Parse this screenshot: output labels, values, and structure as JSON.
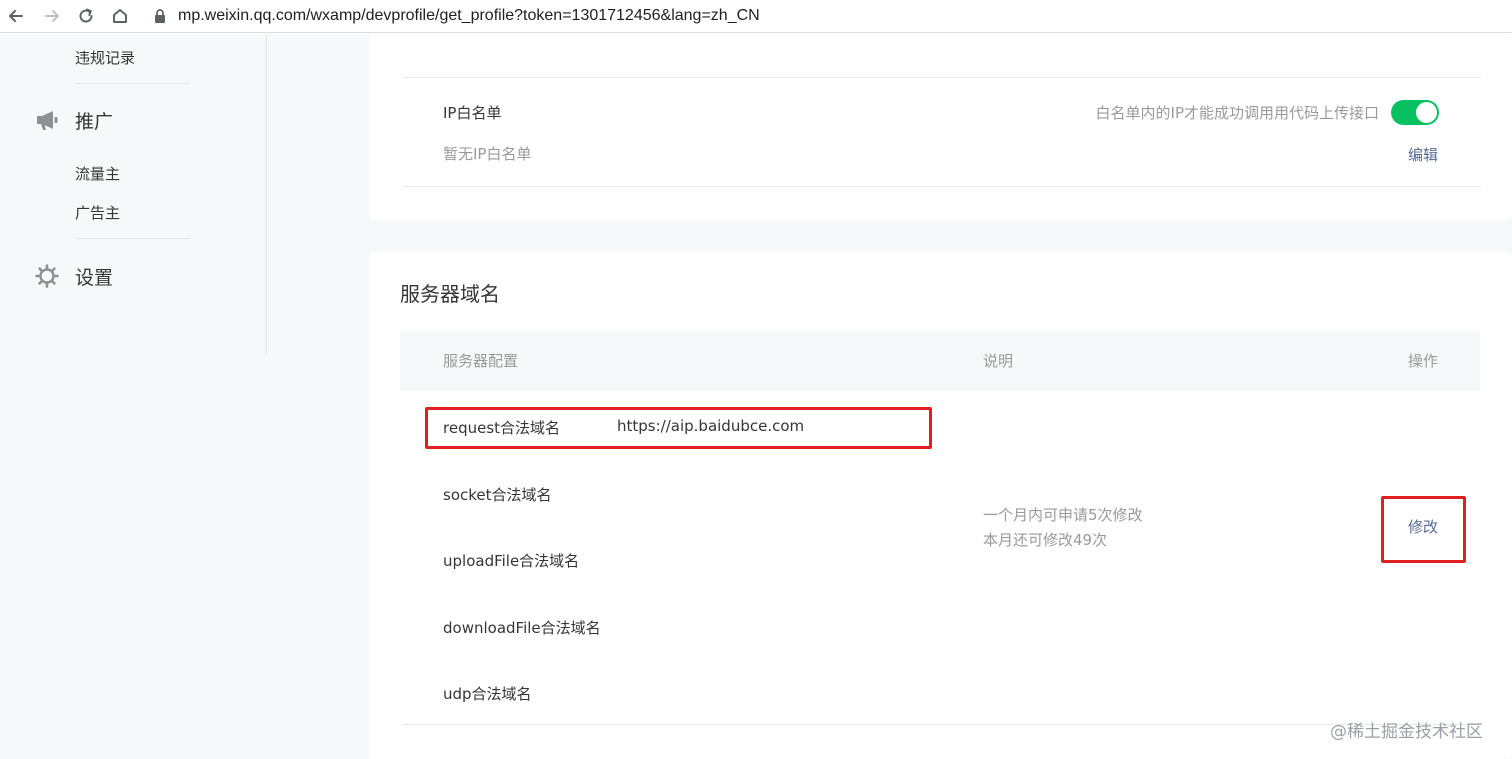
{
  "browser": {
    "url": "mp.weixin.qq.com/wxamp/devprofile/get_profile?token=1301712456&lang=zh_CN",
    "icons": [
      "back-icon",
      "forward-icon",
      "reload-icon",
      "home-icon",
      "lock-icon"
    ]
  },
  "sidebar": {
    "violations_label": "违规记录",
    "promotion": {
      "label": "推广",
      "icon": "megaphone-icon",
      "items": [
        "流量主",
        "广告主"
      ]
    },
    "settings": {
      "label": "设置",
      "icon": "gear-icon"
    }
  },
  "ip_whitelist": {
    "title": "IP白名单",
    "empty_text": "暂无IP白名单",
    "description": "白名单内的IP才能成功调用用代码上传接口",
    "toggle_on": true,
    "edit_label": "编辑"
  },
  "server_domain": {
    "title": "服务器域名",
    "columns": {
      "config": "服务器配置",
      "description": "说明",
      "action": "操作"
    },
    "rows": [
      {
        "label": "request合法域名",
        "value": "https://aip.baidubce.com"
      },
      {
        "label": "socket合法域名",
        "value": ""
      },
      {
        "label": "uploadFile合法域名",
        "value": ""
      },
      {
        "label": "downloadFile合法域名",
        "value": ""
      },
      {
        "label": "udp合法域名",
        "value": ""
      }
    ],
    "note_line1": "一个月内可申请5次修改",
    "note_line2": "本月还可修改49次",
    "modify_label": "修改"
  },
  "watermark": "@稀土掘金技术社区",
  "colors": {
    "toggle": "#07c160",
    "link": "#576b95",
    "annotation": "#e02020",
    "page_bg": "#f6f8f9"
  }
}
